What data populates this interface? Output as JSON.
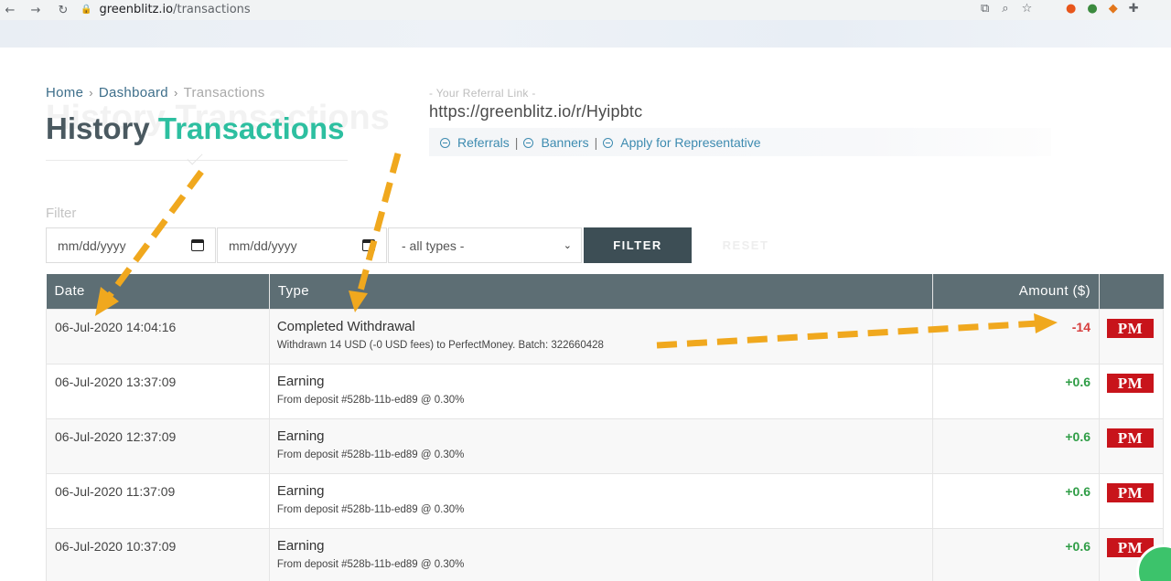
{
  "browser": {
    "url_host": "greenblitz.io",
    "url_path": "/transactions"
  },
  "breadcrumb": {
    "home": "Home",
    "dashboard": "Dashboard",
    "current": "Transactions"
  },
  "title": {
    "ghost": "History Transactions",
    "word1": "History",
    "word2": "Transactions"
  },
  "referral": {
    "label": "- Your Referral Link -",
    "url": "https://greenblitz.io/r/Hyipbtc",
    "links": [
      "Referrals",
      "Banners",
      "Apply for Representative"
    ]
  },
  "filter": {
    "label": "Filter",
    "date_from_placeholder": "mm/dd/yyyy",
    "date_to_placeholder": "mm/dd/yyyy",
    "type_selected": "- all types -",
    "filter_button": "FILTER",
    "reset_button": "RESET"
  },
  "table": {
    "headers": {
      "date": "Date",
      "type": "Type",
      "amount": "Amount ($)"
    },
    "rows": [
      {
        "date": "06-Jul-2020 14:04:16",
        "type": "Completed Withdrawal",
        "desc": "Withdrawn 14 USD (-0 USD fees) to PerfectMoney. Batch: 322660428",
        "amount": "-14",
        "system": "PM"
      },
      {
        "date": "06-Jul-2020 13:37:09",
        "type": "Earning",
        "desc": "From deposit #528b-11b-ed89 @ 0.30%",
        "amount": "+0.6",
        "system": "PM"
      },
      {
        "date": "06-Jul-2020 12:37:09",
        "type": "Earning",
        "desc": "From deposit #528b-11b-ed89 @ 0.30%",
        "amount": "+0.6",
        "system": "PM"
      },
      {
        "date": "06-Jul-2020 11:37:09",
        "type": "Earning",
        "desc": "From deposit #528b-11b-ed89 @ 0.30%",
        "amount": "+0.6",
        "system": "PM"
      },
      {
        "date": "06-Jul-2020 10:37:09",
        "type": "Earning",
        "desc": "From deposit #528b-11b-ed89 @ 0.30%",
        "amount": "+0.6",
        "system": "PM"
      }
    ]
  },
  "colors": {
    "accent_green": "#2dbfa0",
    "header_bg": "#5d6e74",
    "negative": "#d63d3d",
    "positive": "#2f9d46",
    "arrow": "#f0a81e"
  }
}
